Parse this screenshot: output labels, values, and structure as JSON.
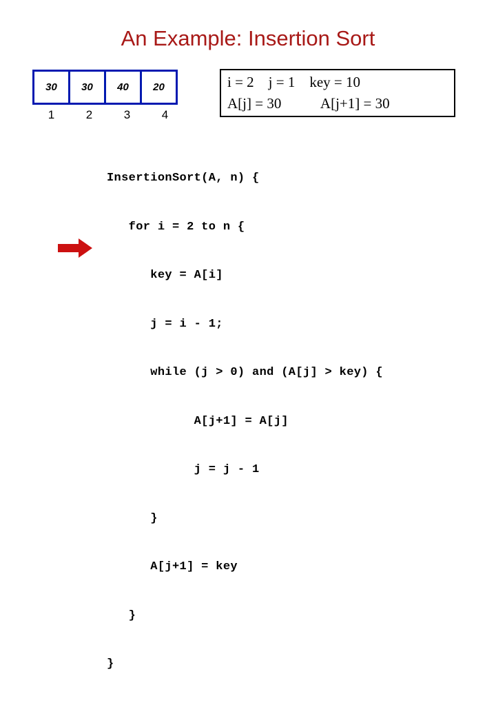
{
  "slide": {
    "title": "An Example: Insertion Sort"
  },
  "array_figure": {
    "name": "array-visualization",
    "border_color": "#0019b0",
    "cells": [
      {
        "value": "30",
        "index": "1"
      },
      {
        "value": "30",
        "index": "2"
      },
      {
        "value": "40",
        "index": "3"
      },
      {
        "value": "20",
        "index": "4"
      }
    ]
  },
  "state_box": {
    "border_color": "#000000",
    "line1": "i = 2    j = 1    key = 10",
    "line2": "A[j] = 30           A[j+1] = 30",
    "variables": {
      "i": "2",
      "j": "1",
      "key": "10",
      "A[j]": "30",
      "A[j+1]": "30"
    }
  },
  "pointer_arrow": {
    "color": "#cc1111",
    "direction": "right",
    "points_to_line": 6
  },
  "code": {
    "language": "pseudocode",
    "lines": [
      "InsertionSort(A, n) {",
      "   for i = 2 to n {",
      "      key = A[i]",
      "      j = i - 1;",
      "      while (j > 0) and (A[j] > key) {",
      "            A[j+1] = A[j]",
      "            j = j - 1",
      "      }",
      "      A[j+1] = key",
      "   }",
      "}"
    ]
  }
}
